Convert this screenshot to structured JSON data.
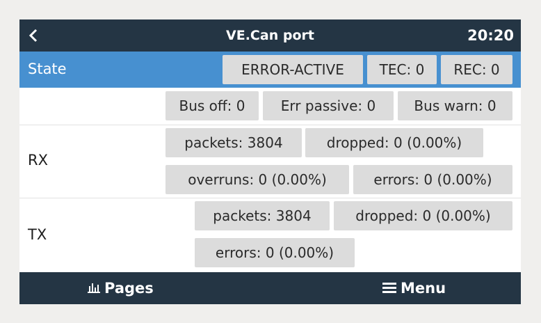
{
  "header": {
    "title": "VE.Can port",
    "time": "20:20",
    "back_icon": "chevron-left-icon"
  },
  "rows": {
    "state": {
      "label": "State",
      "values": [
        "ERROR-ACTIVE",
        "TEC: 0",
        "REC: 0"
      ]
    },
    "bus": {
      "label": "",
      "values": [
        "Bus off: 0",
        "Err passive: 0",
        "Bus warn: 0"
      ]
    },
    "rx": {
      "label": "RX",
      "values": [
        "packets: 3804",
        "dropped: 0 (0.00%)",
        "overruns: 0 (0.00%)",
        "errors: 0 (0.00%)"
      ]
    },
    "tx": {
      "label": "TX",
      "values": [
        "packets: 3804",
        "dropped: 0 (0.00%)",
        "errors: 0 (0.00%)"
      ]
    }
  },
  "footer": {
    "pages_label": "Pages",
    "pages_icon": "bar-chart-icon",
    "menu_label": "Menu",
    "menu_icon": "hamburger-menu-icon"
  },
  "colors": {
    "header_bg": "#243544",
    "selected_row_bg": "#4790d0",
    "chip_bg": "#dcdcdc",
    "page_bg": "#f0efed"
  }
}
